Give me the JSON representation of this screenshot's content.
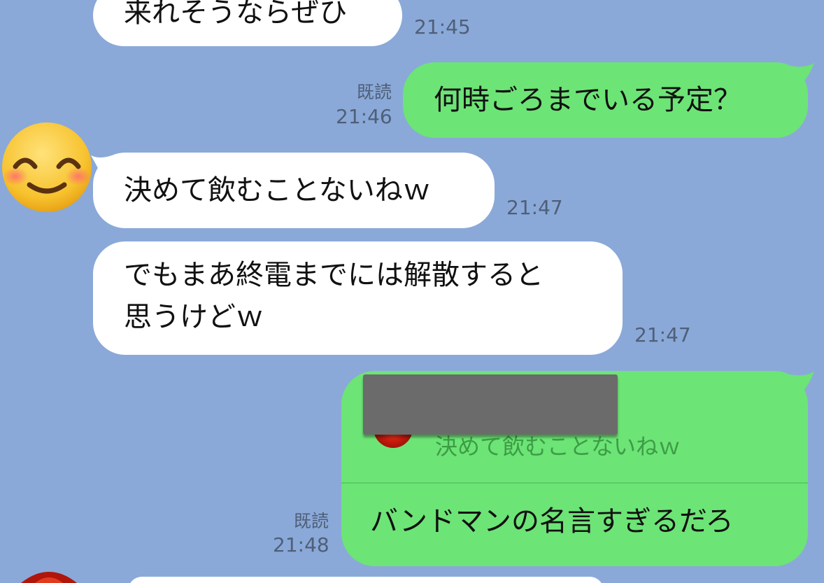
{
  "messages": [
    {
      "side": "in",
      "text": "来れそうならぜひ",
      "time": "21:45"
    },
    {
      "side": "out",
      "text": "何時ごろまでいる予定？",
      "read": "既読",
      "time": "21:46"
    },
    {
      "side": "in",
      "text": "決めて飲むことないねｗ",
      "time": "21:47",
      "avatar": "smiling-face-emoji"
    },
    {
      "side": "in",
      "lines": [
        "でもまあ終電までには解散すると",
        "思うけどｗ"
      ],
      "time": "21:47"
    },
    {
      "side": "out",
      "reply_to": {
        "sender": "[redacted]",
        "text": "決めて飲むことないねｗ"
      },
      "text": "バンドマンの名言すぎるだろ",
      "read": "既読",
      "time": "21:48"
    }
  ],
  "colors": {
    "background": "#8aa9d8",
    "incoming_bubble": "#ffffff",
    "outgoing_bubble": "#6de476",
    "timestamp": "#4f5f78",
    "quote_text": "#3d9c46",
    "redaction": "#6b6b6b"
  },
  "icons": [
    "smiling-face-emoji",
    "red-avatar"
  ]
}
